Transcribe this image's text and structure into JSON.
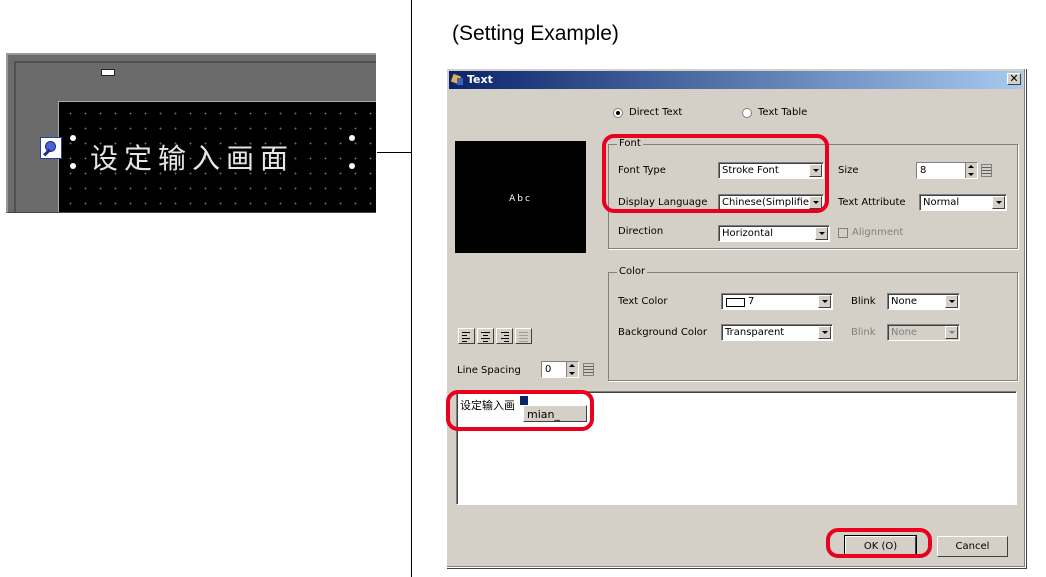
{
  "heading": "(Setting Example)",
  "preview_panel": {
    "text": "设定输入画面"
  },
  "dialog": {
    "title": "Text",
    "close_glyph": "✕",
    "mode": {
      "direct_text": "Direct Text",
      "text_table": "Text Table",
      "selected": "Direct Text"
    },
    "preview_sample": "Abc",
    "font_group": {
      "label": "Font",
      "font_type_label": "Font Type",
      "font_type_value": "Stroke Font",
      "size_label": "Size",
      "size_value": "8",
      "display_language_label": "Display Language",
      "display_language_value": "Chinese(Simplified)",
      "text_attribute_label": "Text Attribute",
      "text_attribute_value": "Normal",
      "direction_label": "Direction",
      "direction_value": "Horizontal",
      "alignment_label": "Alignment"
    },
    "color_group": {
      "label": "Color",
      "text_color_label": "Text Color",
      "text_color_value": "7",
      "blink_label": "Blink",
      "blink_value": "None",
      "background_color_label": "Background Color",
      "background_color_value": "Transparent",
      "bg_blink_label": "Blink",
      "bg_blink_value": "None"
    },
    "line_spacing_label": "Line Spacing",
    "line_spacing_value": "0",
    "text_area": {
      "content": "设定输入画",
      "ime_candidate": "mian_"
    },
    "ok_button": "OK (O)",
    "cancel_button": "Cancel"
  },
  "colors": {
    "highlight": "#e8001e",
    "titlebar_start": "#0a246a",
    "titlebar_end": "#a6caf0",
    "dialog_bg": "#d4d0c8"
  }
}
